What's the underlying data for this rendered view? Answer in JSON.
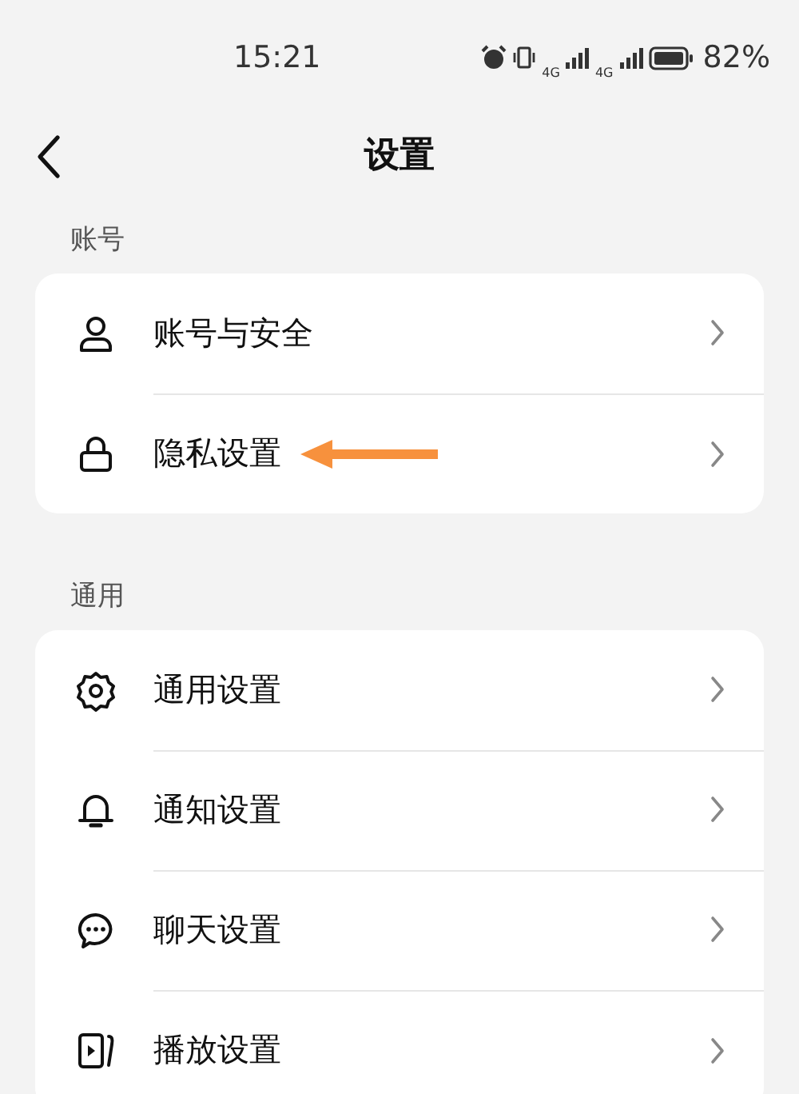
{
  "status_bar": {
    "time": "15:21",
    "network_labels": [
      "4G",
      "4G"
    ],
    "battery": "82%"
  },
  "header": {
    "title": "设置"
  },
  "sections": [
    {
      "label": "账号",
      "items": [
        {
          "label": "账号与安全",
          "pointed_at": false
        },
        {
          "label": "隐私设置",
          "pointed_at": true
        }
      ]
    },
    {
      "label": "通用",
      "items": [
        {
          "label": "通用设置",
          "pointed_at": false
        },
        {
          "label": "通知设置",
          "pointed_at": false
        },
        {
          "label": "聊天设置",
          "pointed_at": false
        },
        {
          "label": "播放设置",
          "pointed_at": false
        }
      ]
    }
  ]
}
